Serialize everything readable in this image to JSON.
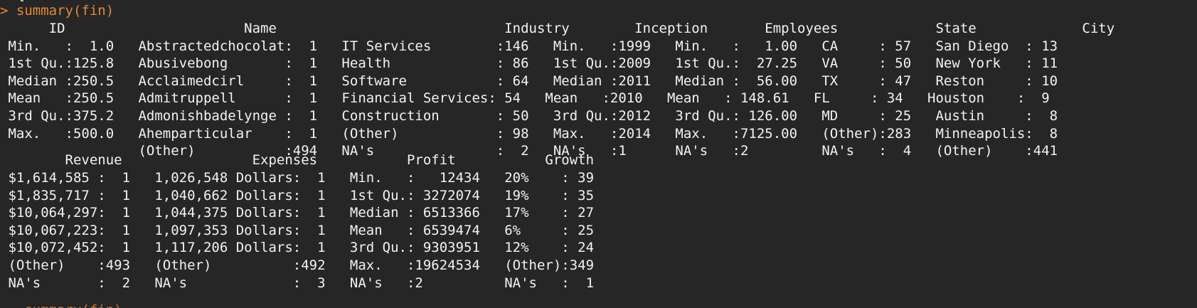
{
  "console": {
    "top_partial": "> [",
    "prompt": "> summary(fin)",
    "bottom_partial": "   summary(fin)",
    "prompt_color": "#e08a39",
    "output_color": "#f2f2f2",
    "background_color": "#262626",
    "output_lines": [
      "      ID                      Name                            Industry        Inception       Employees            State             City     ",
      " Min.   :  1.0   Abstractedchocolat:  1   IT Services        :146   Min.   :1999   Min.   :   1.00   CA     : 57   San Diego  : 13  ",
      " 1st Qu.:125.8   Abusivebong       :  1   Health             : 86   1st Qu.:2009   1st Qu.:  27.25   VA     : 50   New York   : 11  ",
      " Median :250.5   Acclaimedcirl     :  1   Software           : 64   Median :2011   Median :  56.00   TX     : 47   Reston     : 10  ",
      " Mean   :250.5   Admitruppell      :  1   Financial Services: 54   Mean   :2010   Mean   : 148.61   FL     : 34   Houston    :  9  ",
      " 3rd Qu.:375.2   Admonishbadelynge :  1   Construction       : 50   3rd Qu.:2012   3rd Qu.: 126.00   MD     : 25   Austin     :  8  ",
      " Max.   :500.0   Ahemparticular    :  1   (Other)            : 98   Max.   :2014   Max.   :7125.00   (Other):283   Minneapolis:  8  ",
      "                 (Other)           :494   NA's               :  2   NA's   :1      NA's   :2         NA's   :  4   (Other)    :441  ",
      "        Revenue                Expenses           Profit           Growth   ",
      " $1,614,585 :  1   1,026,548 Dollars:  1   Min.   :   12434   20%    : 39  ",
      " $1,835,717 :  1   1,040,662 Dollars:  1   1st Qu.: 3272074   19%    : 35  ",
      " $10,064,297:  1   1,044,375 Dollars:  1   Median : 6513366   17%    : 27  ",
      " $10,067,223:  1   1,097,353 Dollars:  1   Mean   : 6539474   6%     : 25  ",
      " $10,072,452:  1   1,117,206 Dollars:  1   3rd Qu.: 9303951   12%    : 24  ",
      " (Other)    :493   (Other)          :492   Max.   :19624534   (Other):349  ",
      " NA's       :  2   NA's             :  3   NA's   :2          NA's   :  1  "
    ]
  }
}
